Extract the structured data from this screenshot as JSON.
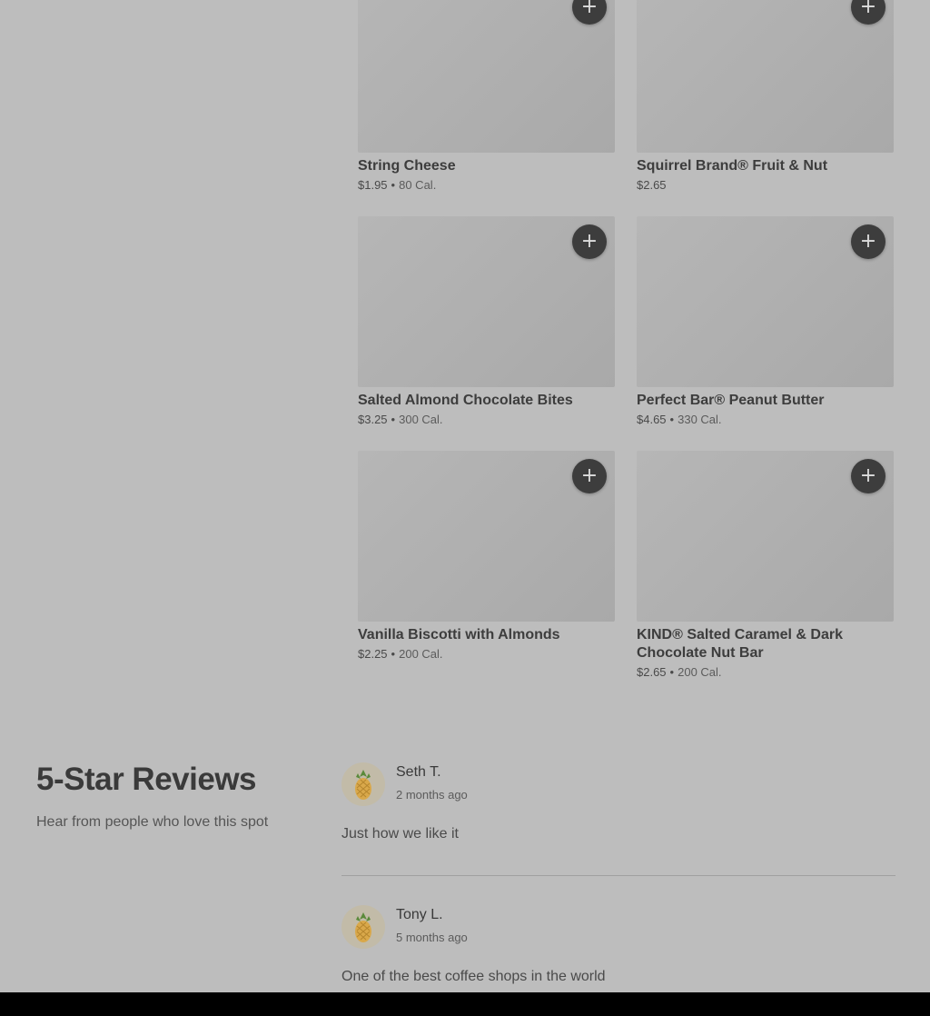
{
  "menu": {
    "items": [
      {
        "name": "String Cheese",
        "price": "$1.95",
        "calories": "80 Cal."
      },
      {
        "name": "Squirrel Brand® Fruit & Nut",
        "price": "$2.65",
        "calories": ""
      },
      {
        "name": "Salted Almond Chocolate Bites",
        "price": "$3.25",
        "calories": "300 Cal."
      },
      {
        "name": "Perfect Bar® Peanut Butter",
        "price": "$4.65",
        "calories": "330 Cal."
      },
      {
        "name": "Vanilla Biscotti with Almonds",
        "price": "$2.25",
        "calories": "200 Cal."
      },
      {
        "name": "KIND® Salted Caramel & Dark Chocolate Nut Bar",
        "price": "$2.65",
        "calories": "200 Cal."
      }
    ],
    "add_label": "+",
    "separator": "•"
  },
  "reviews": {
    "heading": "5-Star Reviews",
    "subheading": "Hear from people who love this spot",
    "items": [
      {
        "name": "Seth T.",
        "time": "2 months ago",
        "text": "Just how we like it",
        "avatar_icon": "pineapple-icon"
      },
      {
        "name": "Tony L.",
        "time": "5 months ago",
        "text": "One of the best coffee shops in the world",
        "avatar_icon": "pineapple-icon"
      }
    ]
  },
  "colors": {
    "overlay_background": "#bdbdbd",
    "button": "#3d3d3d",
    "bottom_bar": "#000000"
  }
}
